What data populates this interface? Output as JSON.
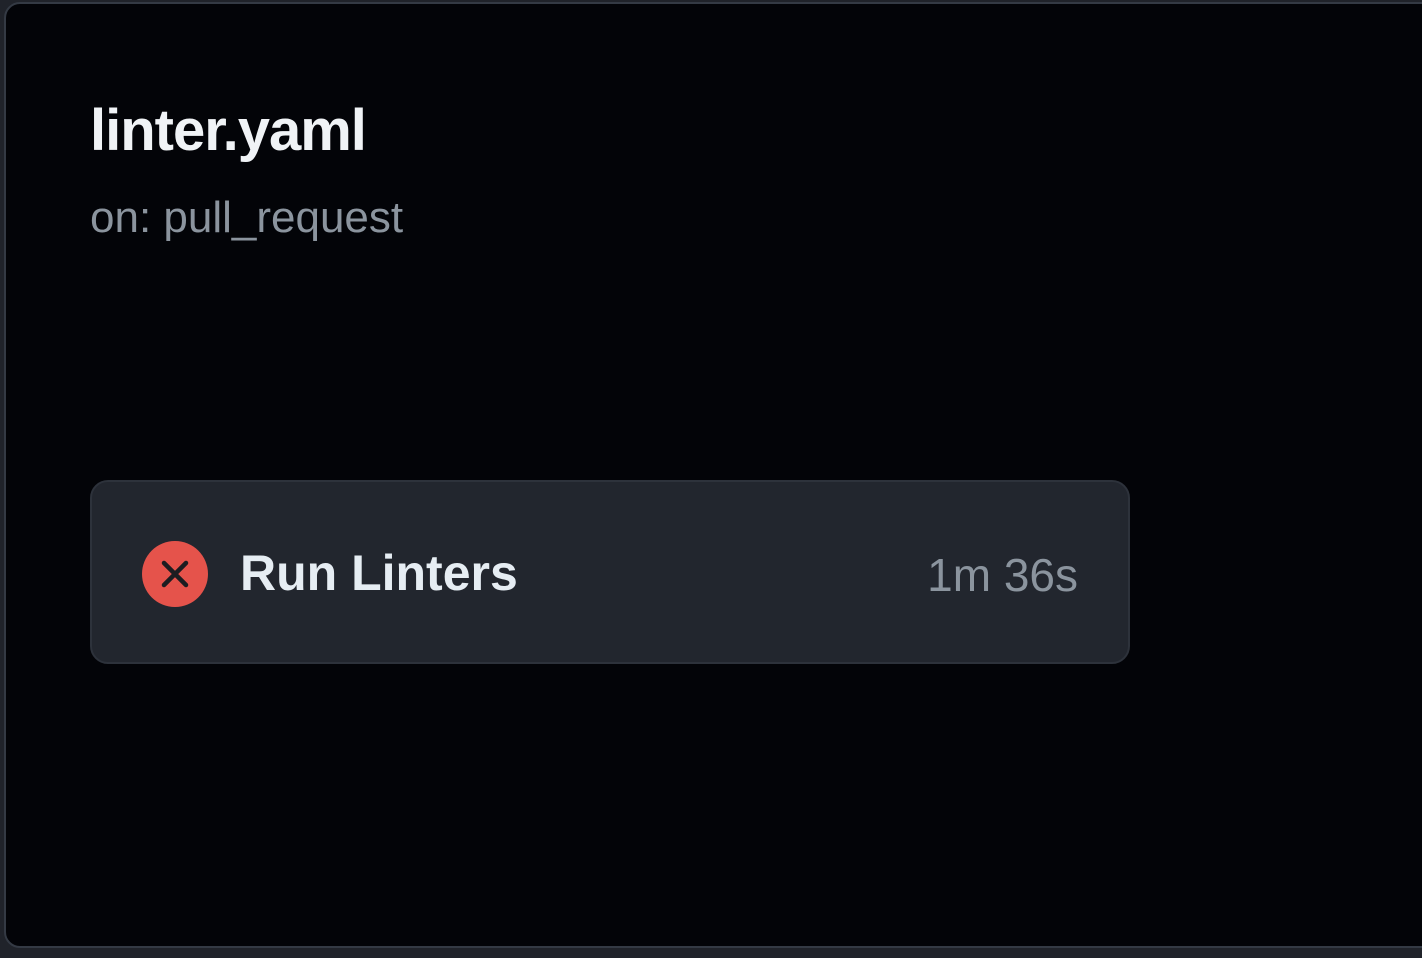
{
  "workflow": {
    "file_name": "linter.yaml",
    "trigger": "on: pull_request"
  },
  "jobs": [
    {
      "name": "Run Linters",
      "duration": "1m 36s",
      "status": "failure",
      "status_icon": "x-circle-fill-icon",
      "status_color": "#e5534b"
    }
  ],
  "colors": {
    "panel_background": "#030408",
    "card_background": "#22262e",
    "title_text": "#f0f3f6",
    "muted_text": "#8b949e"
  }
}
